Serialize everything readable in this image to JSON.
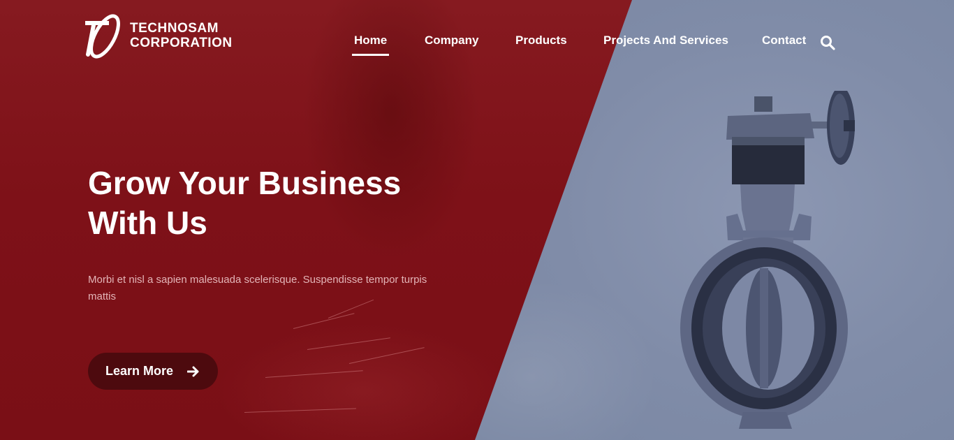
{
  "brand": {
    "line1": "TECHNOSAM",
    "line2": "CORPORATION"
  },
  "nav": {
    "items": [
      {
        "label": "Home",
        "active": true
      },
      {
        "label": "Company",
        "active": false
      },
      {
        "label": "Products",
        "active": false
      },
      {
        "label": "Projects And Services",
        "active": false
      },
      {
        "label": "Contact",
        "active": false
      }
    ],
    "search_icon": "search-icon"
  },
  "hero": {
    "headline_line1": "Grow Your Business",
    "headline_line2": "With Us",
    "subtext": "Morbi et nisl a sapien malesuada scelerisque. Suspendisse tempor turpis mattis",
    "cta_label": "Learn More",
    "cta_icon": "arrow-right-icon"
  },
  "colors": {
    "brand_red": "#7e1118",
    "overlay_blue": "#808ca8",
    "cta_bg": "#4d0a0e",
    "text_white": "#ffffff"
  }
}
